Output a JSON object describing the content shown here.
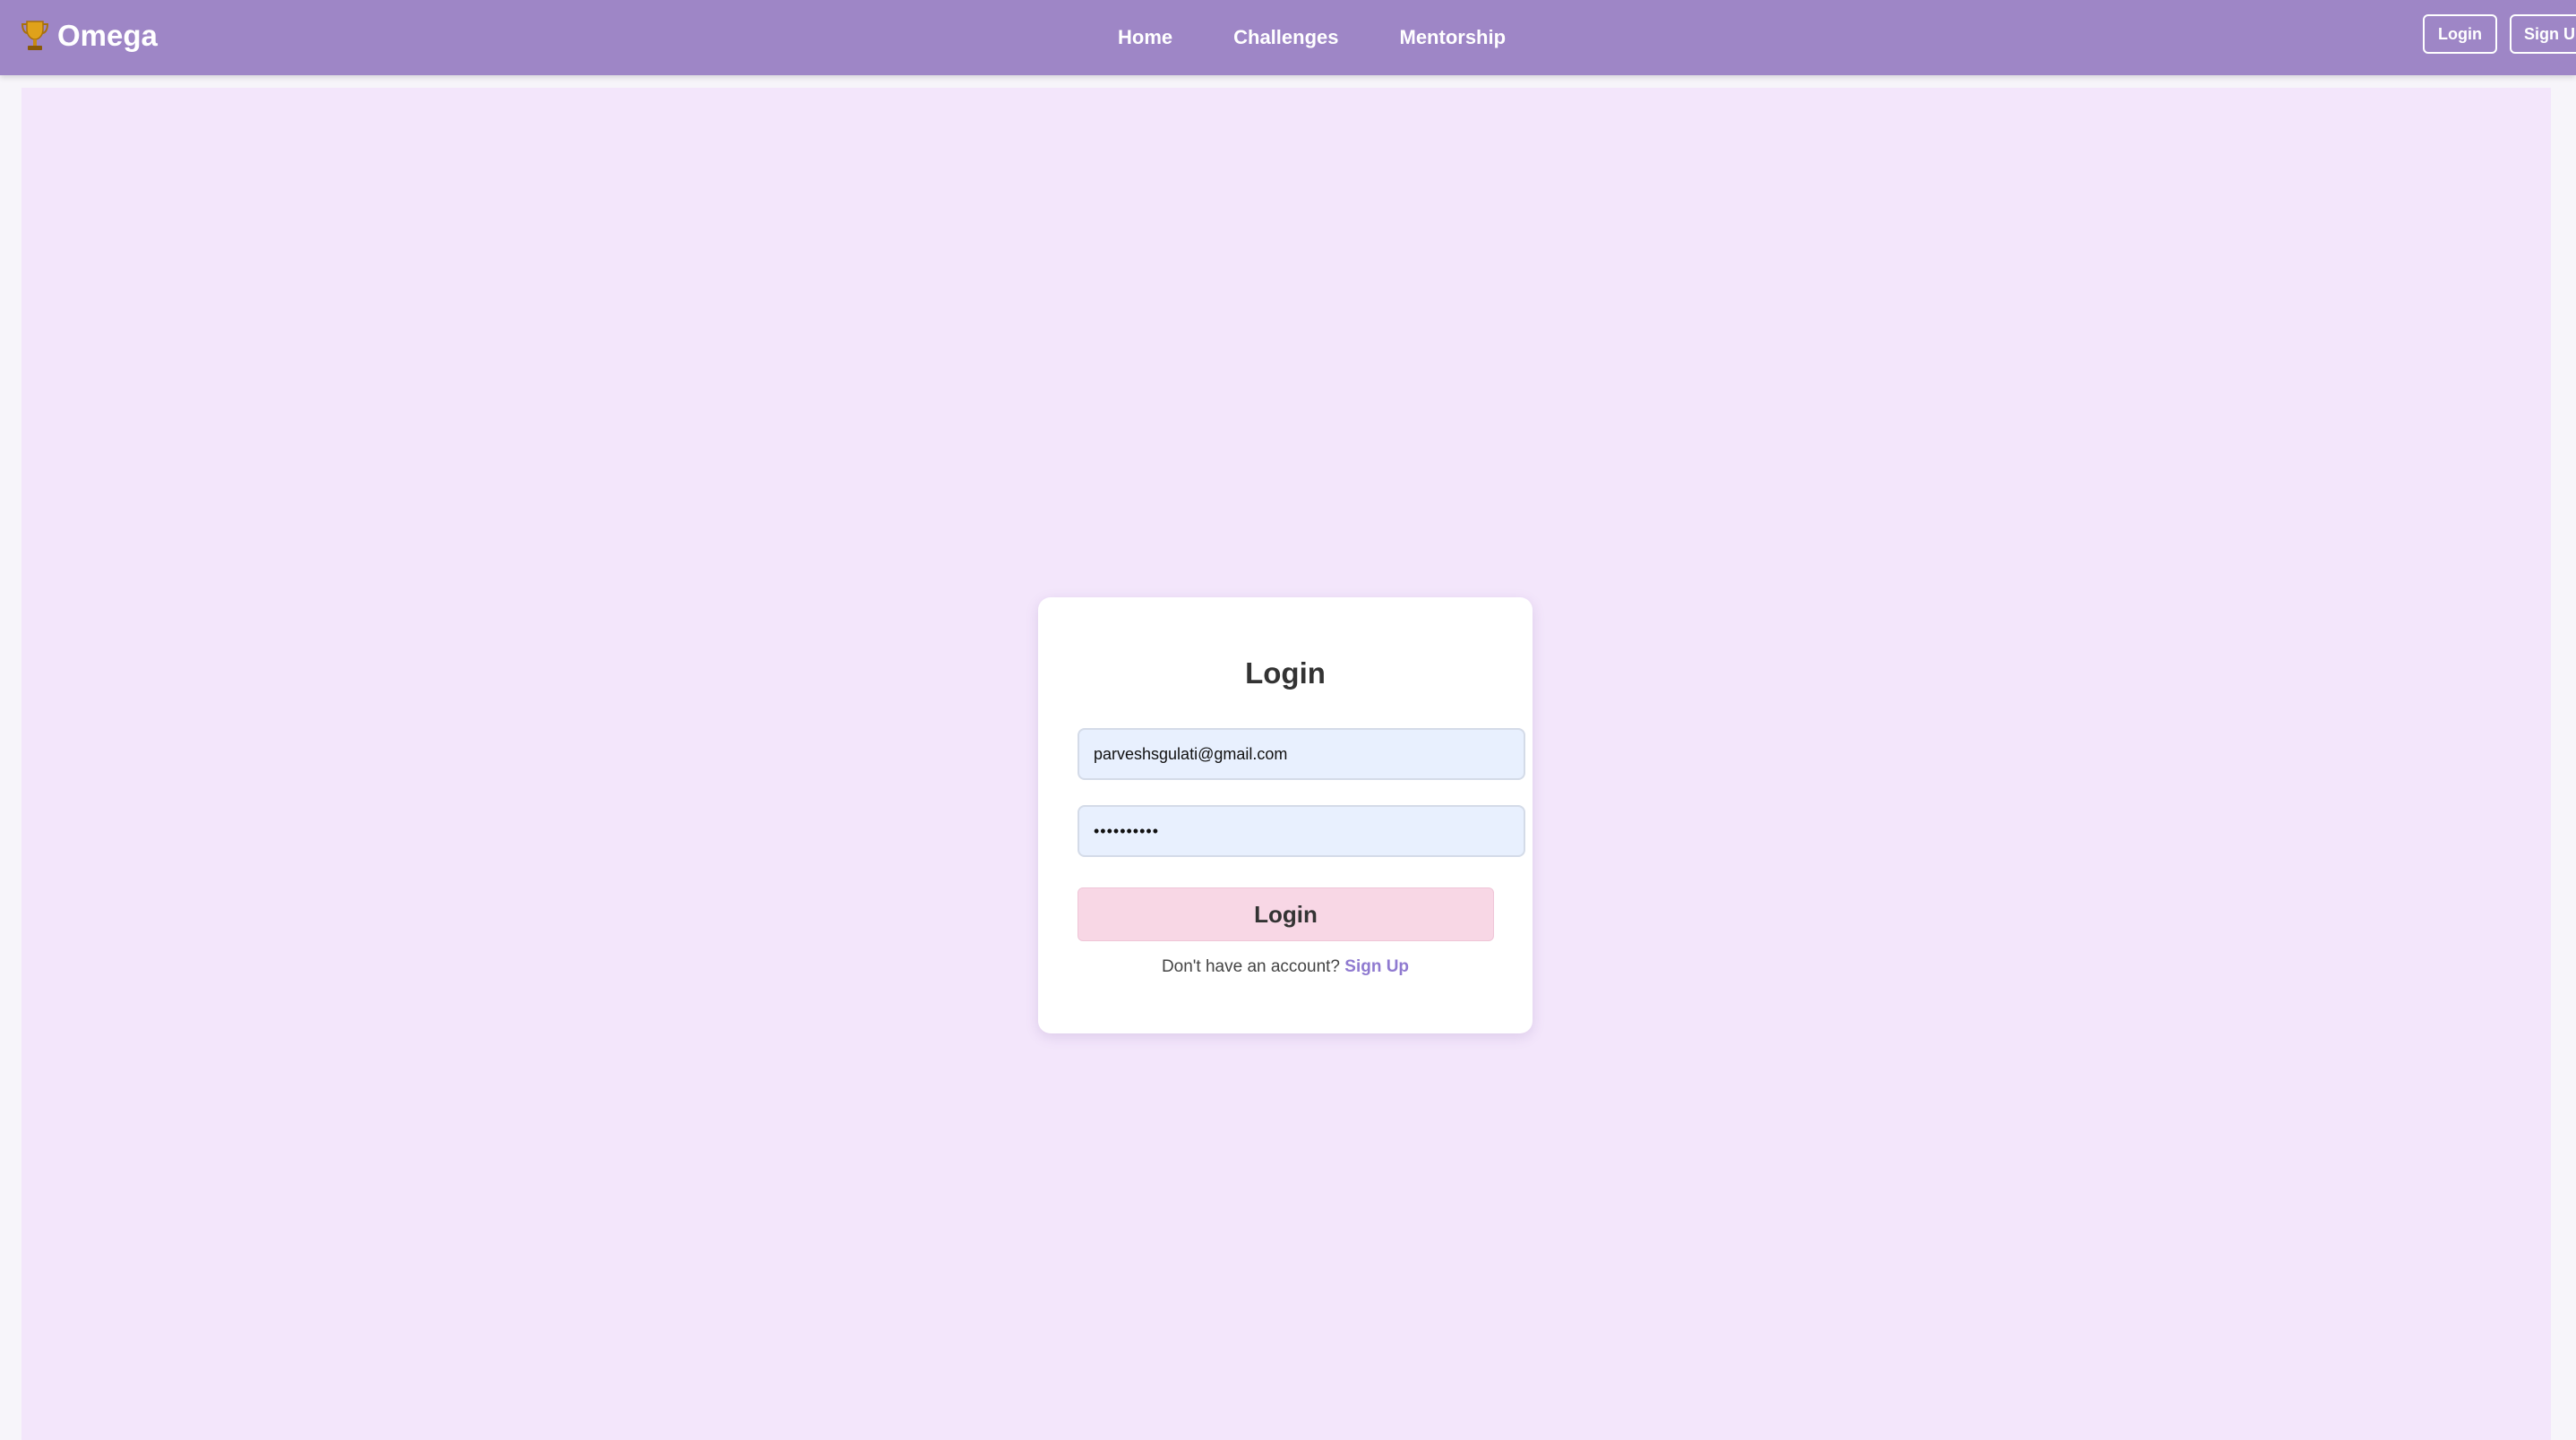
{
  "navbar": {
    "brand": "Omega",
    "links": [
      "Home",
      "Challenges",
      "Mentorship"
    ],
    "login_label": "Login",
    "signup_label": "Sign U"
  },
  "card": {
    "title": "Login",
    "email_value": "parveshsgulati@gmail.com",
    "password_value": "••••••••••",
    "login_button": "Login",
    "no_account_text": "Don't have an account?",
    "signup_link": "Sign Up"
  },
  "colors": {
    "navbar": "#9e86c6",
    "background": "#f3e6fb",
    "card": "#ffffff",
    "input": "#e8f0fe",
    "login_button": "#f8d7e5",
    "link": "#8f7ad0"
  },
  "icons": {
    "brand": "trophy-icon"
  }
}
